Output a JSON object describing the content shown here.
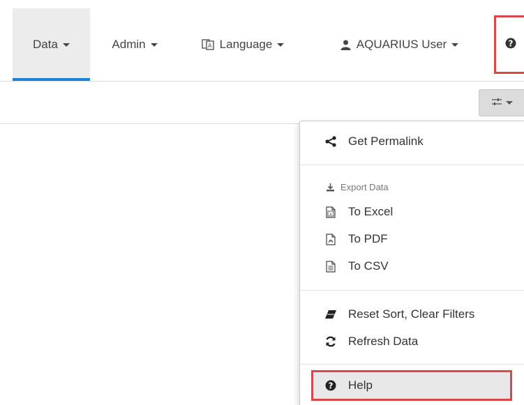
{
  "nav": {
    "data_label": "Data",
    "admin_label": "Admin",
    "language_label": "Language",
    "user_label": "AQUARIUS User"
  },
  "menu": {
    "get_permalink": "Get Permalink",
    "export_header": "Export Data",
    "to_excel": "To Excel",
    "to_pdf": "To PDF",
    "to_csv": "To CSV",
    "reset_sort": "Reset Sort, Clear Filters",
    "refresh_data": "Refresh Data",
    "help": "Help"
  },
  "colors": {
    "accent": "#1f82d6",
    "highlight_box": "#d94848"
  },
  "icons": {
    "language": "language-icon",
    "user": "user-icon",
    "help": "question-circle-icon",
    "settings": "sliders-icon",
    "share": "share-icon",
    "download": "download-icon",
    "excel": "file-excel-icon",
    "pdf": "file-pdf-icon",
    "csv": "file-text-icon",
    "eraser": "eraser-icon",
    "refresh": "refresh-icon"
  }
}
